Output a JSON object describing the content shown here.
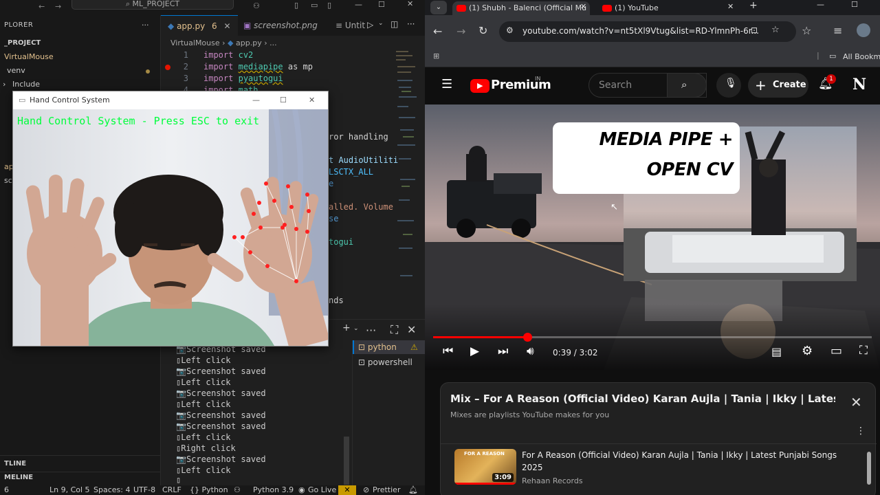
{
  "vscode": {
    "title_search": "ML_PROJECT",
    "explorer_title": "PLORER",
    "explorer_more": "···",
    "tree": {
      "project": "_PROJECT",
      "folder": "VirtualMouse",
      "venv": "venv",
      "include": "Include",
      "ap": "ap",
      "sc": "sc",
      "outline": "TLINE",
      "timeline": "MELINE"
    },
    "tabs": [
      {
        "label": "app.py",
        "badge": "6"
      },
      {
        "label": "screenshot.png"
      },
      {
        "label": "Untit"
      }
    ],
    "breadcrumb": {
      "folder": "VirtualMouse",
      "file": "app.py",
      "rest": "..."
    },
    "code": [
      {
        "n": "1",
        "kw": "import",
        "mod": "cv2",
        "rest": ""
      },
      {
        "n": "2",
        "kw": "import",
        "mod": "mediapipe",
        "rest": " as mp"
      },
      {
        "n": "3",
        "kw": "import",
        "mod": "pyautogui",
        "rest": ""
      },
      {
        "n": "4",
        "kw": "import",
        "mod": "math",
        "rest": ""
      }
    ],
    "code_fragments": [
      "ror handling",
      "t AudioUtiliti",
      "LSCTX_ALL",
      "e",
      "alled. Volume",
      "se",
      "togui",
      "nds"
    ],
    "terminal_lines": [
      "Screenshot saved",
      "Left click",
      "Screenshot saved",
      "Left click",
      "Screenshot saved",
      "Left click",
      "Screenshot saved",
      "Screenshot saved",
      "Left click",
      "Right click",
      "Screenshot saved",
      "Left click"
    ],
    "terminals": [
      {
        "label": "python"
      },
      {
        "label": "powershell"
      }
    ],
    "status": {
      "ln_col": "Ln 9, Col 5",
      "spaces": "Spaces: 4",
      "encoding": "UTF-8",
      "eol": "CRLF",
      "lang": "{} Python",
      "python_ver": "Python 3.9",
      "golive": "Go Live",
      "prettier": "Prettier",
      "left_num": "6"
    }
  },
  "hand_window": {
    "title": "Hand Control System",
    "overlay": "Hand Control System - Press ESC to exit"
  },
  "chrome": {
    "tabs": [
      {
        "label": "(1) Shubh - Balenci (Official Mu"
      },
      {
        "label": "(1) YouTube"
      }
    ],
    "url": "youtube.com/watch?v=nt5tXl9Vtug&list=RD-YlmnPh-6r...",
    "bookmarks": "All Bookm"
  },
  "youtube": {
    "brand": "Premium",
    "region": "IN",
    "search_placeholder": "Search",
    "create": "Create",
    "notif_count": "1",
    "avatar": "N",
    "overlay_line1": "MEDIA PIPE +",
    "overlay_line2": "OPEN CV",
    "time": "0:39 / 3:02",
    "progress": 0.215,
    "playlist": {
      "title": "Mix – For A Reason (Official Video) Karan Aujla | Tania | Ikky | Latest...",
      "subtitle": "Mixes are playlists YouTube makes for you",
      "item": {
        "title": "For A Reason (Official Video) Karan Aujla | Tania | Ikky | Latest Punjabi Songs 2025",
        "channel": "Rehaan Records",
        "duration": "3:09",
        "thumb_text": "FOR A REASON"
      }
    }
  },
  "colors": {
    "vs_bg": "#1f1f1f",
    "yt_red": "#ff0000",
    "overlay_green": "#00ff3c",
    "landmark": "#ff2020"
  }
}
